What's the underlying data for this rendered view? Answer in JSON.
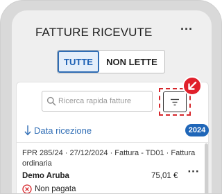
{
  "header": {
    "title": "FATTURE RICEVUTE",
    "more_icon": "more-horizontal-icon"
  },
  "segment": {
    "all_label": "TUTTE",
    "unread_label": "NON LETTE",
    "selected": "TUTTE"
  },
  "search": {
    "placeholder": "Ricerca rapida fatture",
    "value": ""
  },
  "filter": {
    "icon": "filter-lines-icon",
    "callout_icon": "arrow-down-left-icon",
    "accent": "#e0202b"
  },
  "sort": {
    "label": "Data ricezione",
    "icon": "arrow-down-icon"
  },
  "year_badge": "2024",
  "invoices": [
    {
      "meta": "FPR 285/24 · 27/12/2024 · Fattura - TD01 · Fattura ordinaria",
      "supplier": "Demo Aruba",
      "amount": "75,01 €",
      "status": "Non pagata",
      "status_icon": "circle-x-icon",
      "status_color": "#d6262b"
    }
  ],
  "colors": {
    "primary": "#1f66b8",
    "link": "#2f6db5",
    "alert": "#e0202b"
  }
}
